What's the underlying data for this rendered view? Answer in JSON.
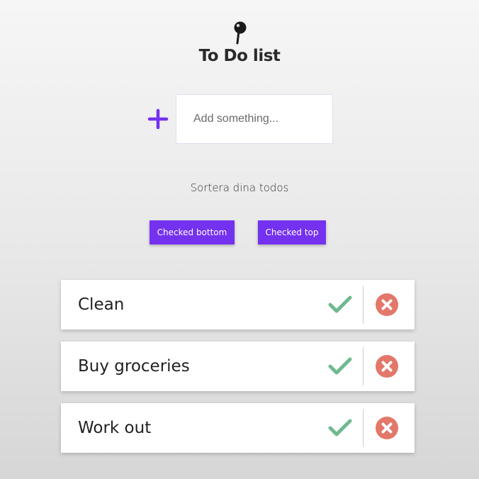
{
  "app": {
    "title": "To Do list",
    "pin_icon": "pin-icon",
    "accent_color": "#7431f0"
  },
  "add": {
    "placeholder": "Add something...",
    "icon": "plus-icon"
  },
  "sort": {
    "label": "Sortera dina todos",
    "buttons": {
      "checked_bottom": "Checked bottom",
      "checked_top": "Checked top"
    }
  },
  "todos": [
    {
      "text": "Clean",
      "check_icon": "check-icon",
      "delete_icon": "delete-circle-icon"
    },
    {
      "text": "Buy groceries",
      "check_icon": "check-icon",
      "delete_icon": "delete-circle-icon"
    },
    {
      "text": "Work out",
      "check_icon": "check-icon",
      "delete_icon": "delete-circle-icon"
    }
  ],
  "colors": {
    "check": "#6fb98f",
    "delete": "#e2776a"
  }
}
